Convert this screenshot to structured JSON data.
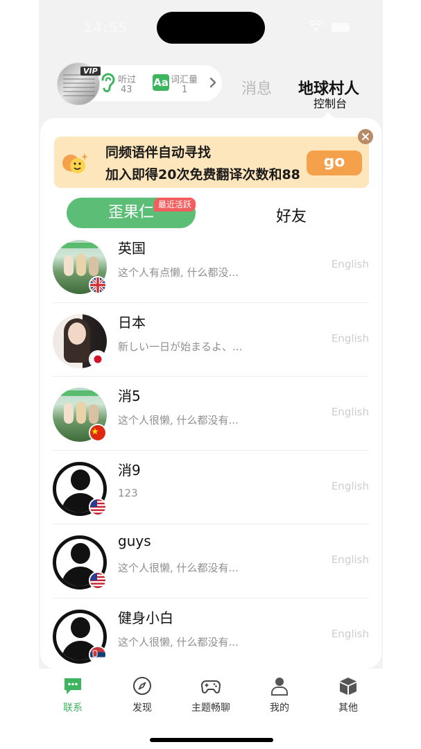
{
  "status_bar": {
    "time": "14:55"
  },
  "header": {
    "vip_badge": "VIP",
    "listened_label": "听过",
    "listened_count": "43",
    "vocab_icon_text": "Aa",
    "vocab_label": "词汇量",
    "vocab_count": "1",
    "tab_messages": "消息",
    "tab_earth": "地球村人",
    "tab_earth_sub": "控制台"
  },
  "banner": {
    "title": "同频语伴自动寻找",
    "subtitle": "加入即得20次免费翻译次数和88",
    "go_label": "go"
  },
  "segments": {
    "active": "歪果仁",
    "badge": "最近活跃",
    "friends": "好友"
  },
  "contacts": [
    {
      "name": "英国",
      "sub": "这个人有点懒, 什么都没...",
      "lang": "English",
      "flag": "uk",
      "avatar": "group-photo"
    },
    {
      "name": "日本",
      "sub": "新しい一日が始まるよ、...",
      "lang": "English",
      "flag": "japan",
      "avatar": "woman-photo"
    },
    {
      "name": "消5",
      "sub": "这个人很懒, 什么都没有...",
      "lang": "English",
      "flag": "china",
      "avatar": "group-photo"
    },
    {
      "name": "消9",
      "sub": "123",
      "lang": "English",
      "flag": "usa",
      "avatar": "default"
    },
    {
      "name": "guys",
      "sub": "这个人很懒, 什么都没有...",
      "lang": "English",
      "flag": "usa",
      "avatar": "default"
    },
    {
      "name": "健身小白",
      "sub": "这个人很懒, 什么都没有...",
      "lang": "English",
      "flag": "serbia",
      "avatar": "default"
    }
  ],
  "tabbar": {
    "contacts": "联系",
    "discover": "发现",
    "topics": "主题畅聊",
    "me": "我的",
    "other": "其他"
  },
  "colors": {
    "accent": "#3db55e",
    "go": "#f5a04a",
    "banner_bg": "#fde5bc",
    "badge": "#f35d5d"
  }
}
